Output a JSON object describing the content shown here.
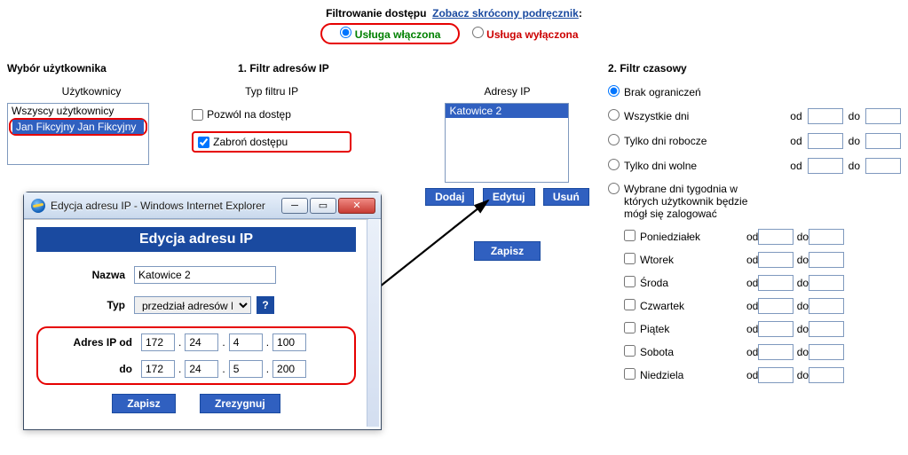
{
  "header": {
    "title": "Filtrowanie dostępu",
    "link": "Zobacz skrócony podręcznik",
    "colon": ":"
  },
  "service": {
    "on": "Usługa włączona",
    "off": "Usługa wyłączona"
  },
  "user_col": {
    "title": "Wybór użytkownika",
    "sub": "Użytkownicy",
    "user_all": "Wszyscy użytkownicy",
    "user_sel": "Jan Fikcyjny Jan Fikcyjny"
  },
  "ip_col": {
    "title": "1. Filtr adresów IP",
    "type_sub": "Typ filtru IP",
    "addr_sub": "Adresy IP",
    "allow": "Pozwól na dostęp",
    "deny": "Zabroń dostępu",
    "add": "Dodaj",
    "edit": "Edytuj",
    "del": "Usuń",
    "addr_sel": "Katowice 2"
  },
  "time_col": {
    "title": "2. Filtr czasowy",
    "no_limit": "Brak ograniczeń",
    "all_days": "Wszystkie dni",
    "work_days": "Tylko dni robocze",
    "free_days": "Tylko dni wolne",
    "sel_days": "Wybrane dni tygodnia w których użytkownik będzie mógł się zalogować",
    "od": "od",
    "do": "do",
    "days": {
      "d1": "Poniedziałek",
      "d2": "Wtorek",
      "d3": "Środa",
      "d4": "Czwartek",
      "d5": "Piątek",
      "d6": "Sobota",
      "d7": "Niedziela"
    }
  },
  "popup": {
    "window_title": "Edycja adresu IP - Windows Internet Explorer",
    "heading": "Edycja adresu IP",
    "name_lbl": "Nazwa",
    "name_val": "Katowice 2",
    "type_lbl": "Typ",
    "type_val": "przedział adresów IP",
    "help": "?",
    "from_lbl": "Adres IP od",
    "to_lbl": "do",
    "o1": "172",
    "o2": "24",
    "o3": "4",
    "o4": "100",
    "p1": "172",
    "p2": "24",
    "p3": "5",
    "p4": "200",
    "save": "Zapisz",
    "cancel": "Zrezygnuj"
  },
  "main_save": "Zapisz",
  "icons": {
    "minimize": "─",
    "maximize": "▭",
    "close": "✕"
  }
}
